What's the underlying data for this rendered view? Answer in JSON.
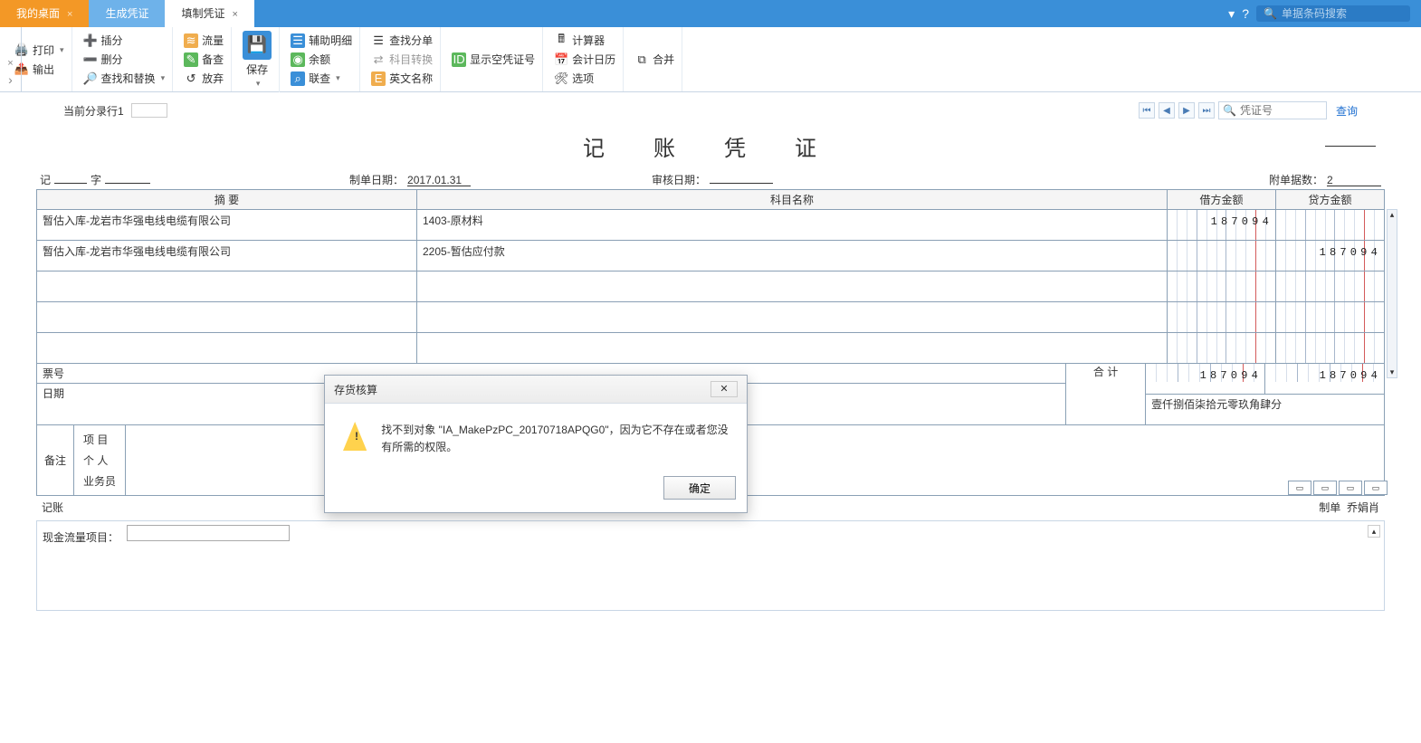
{
  "tabs": [
    {
      "label": "我的桌面",
      "closable": true
    },
    {
      "label": "生成凭证"
    },
    {
      "label": "填制凭证",
      "closable": true
    }
  ],
  "search": {
    "placeholder": "单据条码搜索"
  },
  "ribbon": {
    "print": "打印",
    "output": "输出",
    "insert_entry": "插分",
    "delete_entry": "删分",
    "find_replace": "查找和替换",
    "flow": "流量",
    "audit": "备查",
    "discard": "放弃",
    "save": "保存",
    "aux_detail": "辅助明细",
    "balance": "余额",
    "lookup": "联查",
    "find_entry": "查找分单",
    "subject_convert": "科目转换",
    "english_name": "英文名称",
    "show_blank": "显示空凭证号",
    "calculator": "计算器",
    "calendar": "会计日历",
    "options": "选项",
    "merge": "合并"
  },
  "subheader": {
    "current_entry": "当前分录行1"
  },
  "nav": {
    "placeholder": "凭证号",
    "query": "查询"
  },
  "voucher": {
    "title": "记 账 凭 证",
    "word_prefix": "记",
    "word_suffix": "字",
    "make_date_label": "制单日期：",
    "make_date": "2017.01.31",
    "audit_date_label": "审核日期：",
    "attach_label": "附单据数：",
    "attach": "2",
    "headers": {
      "abstract": "摘 要",
      "subject": "科目名称",
      "debit": "借方金额",
      "credit": "贷方金额"
    },
    "rows": [
      {
        "abstract": "暂估入库-龙岩市华强电线电缆有限公司",
        "subject": "1403-原材料",
        "debit": "187094",
        "credit": ""
      },
      {
        "abstract": "暂估入库-龙岩市华强电线电缆有限公司",
        "subject": "2205-暂估应付款",
        "debit": "",
        "credit": "187094"
      },
      {},
      {},
      {}
    ],
    "ticket_label": "票号",
    "date_label": "日期",
    "total_label": "合 计",
    "total_debit": "187094",
    "total_credit": "187094",
    "amount_cn": "壹仟捌佰柒拾元零玖角肆分",
    "note_label": "备注",
    "project": "项 目",
    "person": "个 人",
    "biz": "业务员",
    "jz": "记账",
    "maker": "制单",
    "maker_name": "乔娟肖"
  },
  "cash_flow": {
    "label": "现金流量项目："
  },
  "modal": {
    "title": "存货核算",
    "message": "找不到对象 \"IA_MakePzPC_20170718APQG0\"，因为它不存在或者您没有所需的权限。",
    "ok": "确定"
  }
}
